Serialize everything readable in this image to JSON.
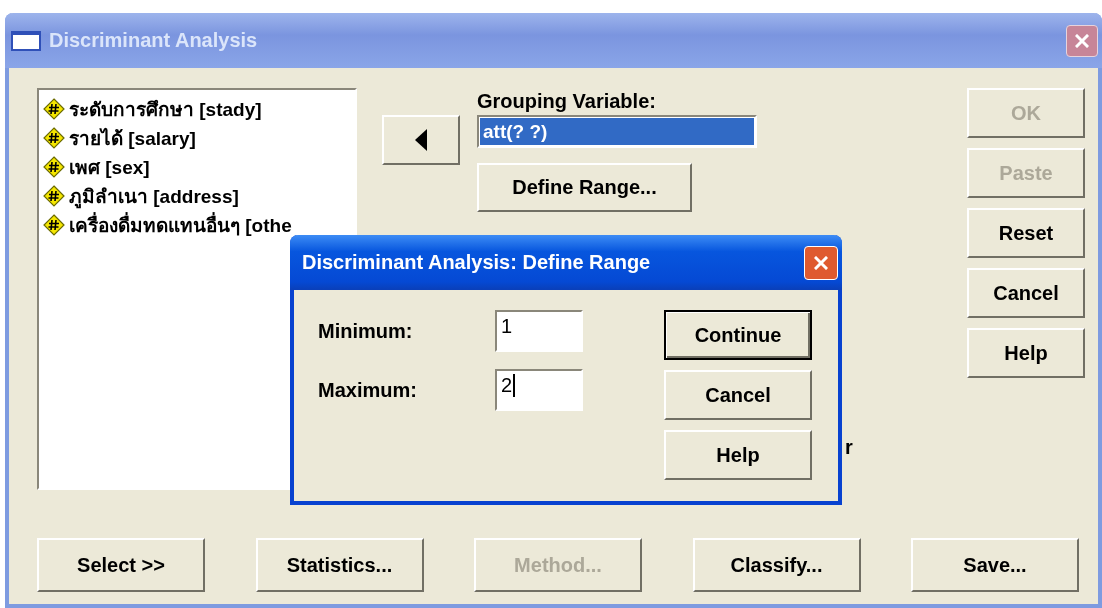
{
  "window": {
    "title": "Discriminant Analysis"
  },
  "variables": [
    {
      "label": "ระดับการศึกษา [stady]"
    },
    {
      "label": "รายได้ [salary]"
    },
    {
      "label": "เพศ [sex]"
    },
    {
      "label": "ภูมิลำเนา [address]"
    },
    {
      "label": "เครื่องดื่มทดแทนอื่นๆ [othe"
    }
  ],
  "grouping": {
    "label": "Grouping Variable:",
    "value": "att(? ?)",
    "selected": true
  },
  "define_range_button": "Define Range...",
  "side_buttons": [
    {
      "label": "OK",
      "disabled": true
    },
    {
      "label": "Paste",
      "disabled": true
    },
    {
      "label": "Reset",
      "disabled": false
    },
    {
      "label": "Cancel",
      "disabled": false
    },
    {
      "label": "Help",
      "disabled": false
    }
  ],
  "label_fragment": "r",
  "bottom_buttons": [
    {
      "label": "Select >>",
      "disabled": false
    },
    {
      "label": "Statistics...",
      "disabled": false
    },
    {
      "label": "Method...",
      "disabled": true
    },
    {
      "label": "Classify...",
      "disabled": false
    },
    {
      "label": "Save...",
      "disabled": false
    }
  ],
  "dialog": {
    "title": "Discriminant Analysis: Define Range",
    "fields": [
      {
        "label": "Minimum:",
        "value": "1",
        "focused": false
      },
      {
        "label": "Maximum:",
        "value": "2",
        "focused": true
      }
    ],
    "buttons": [
      {
        "label": "Continue",
        "default": true
      },
      {
        "label": "Cancel",
        "default": false
      },
      {
        "label": "Help",
        "default": false
      }
    ]
  }
}
